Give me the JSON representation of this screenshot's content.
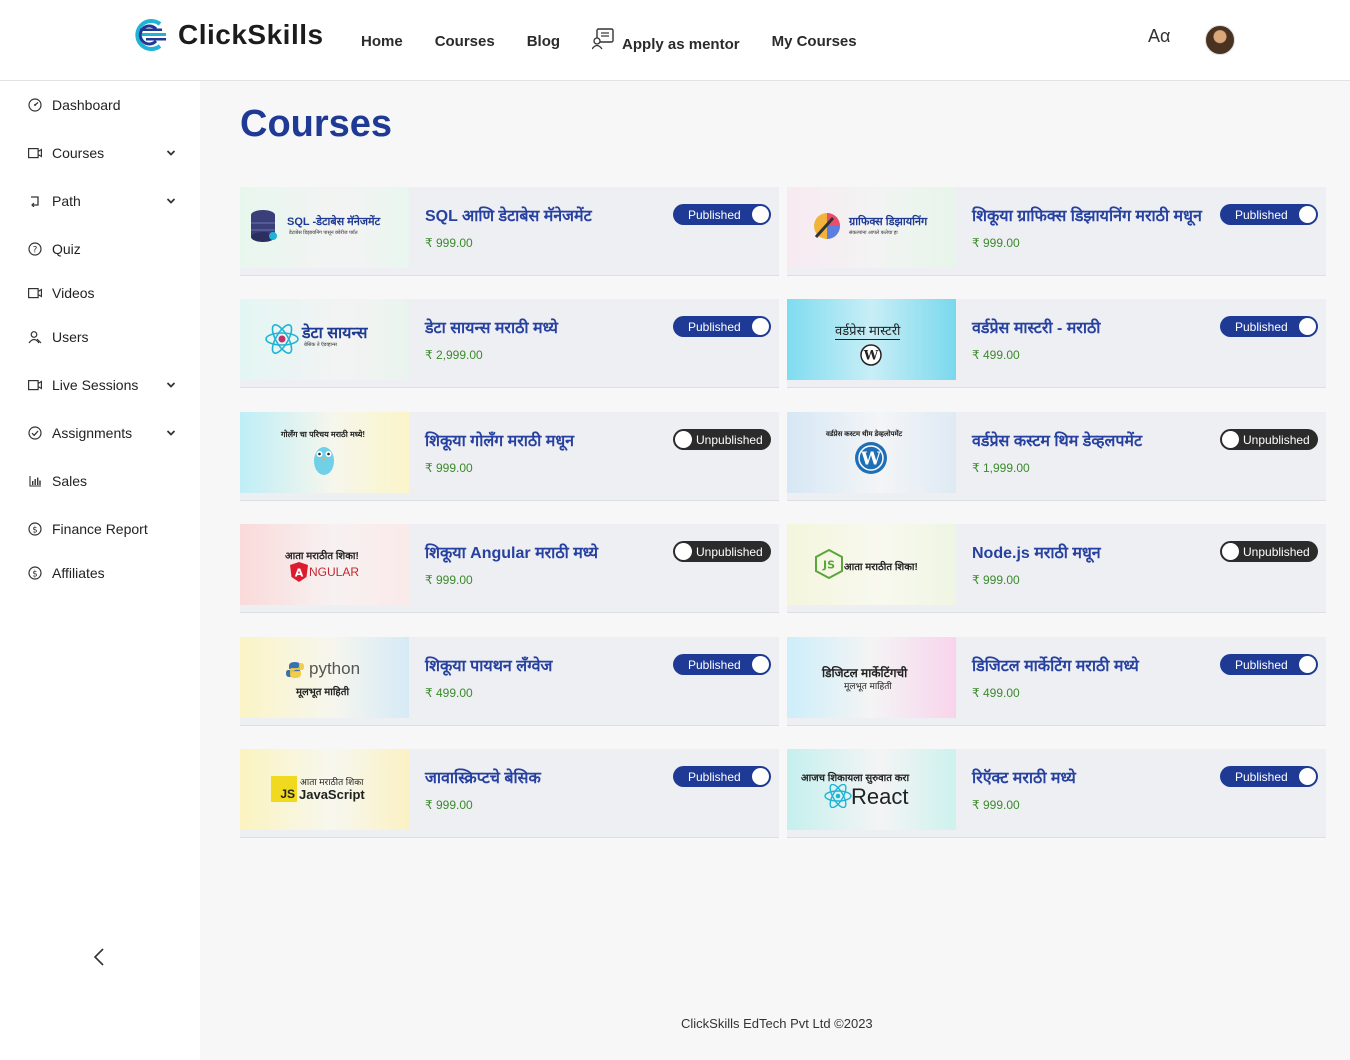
{
  "brand": {
    "name": "ClickSkills"
  },
  "nav": {
    "home": "Home",
    "courses": "Courses",
    "blog": "Blog",
    "mentor": "Apply as mentor",
    "my_courses": "My Courses",
    "font_toggle": "Aα"
  },
  "sidebar": {
    "items": [
      {
        "label": "Dashboard",
        "icon": "dashboard-icon"
      },
      {
        "label": "Courses",
        "icon": "video-icon",
        "expandable": true
      },
      {
        "label": "Path",
        "icon": "path-icon",
        "expandable": true
      },
      {
        "label": "Quiz",
        "icon": "quiz-icon"
      },
      {
        "label": "Videos",
        "icon": "video-icon"
      },
      {
        "label": "Users",
        "icon": "users-icon"
      },
      {
        "label": "Live Sessions",
        "icon": "video-icon",
        "expandable": true
      },
      {
        "label": "Assignments",
        "icon": "check-circle-icon",
        "expandable": true
      },
      {
        "label": "Sales",
        "icon": "bar-chart-icon"
      },
      {
        "label": "Finance Report",
        "icon": "dollar-icon"
      },
      {
        "label": "Affiliates",
        "icon": "dollar-icon"
      }
    ]
  },
  "main": {
    "title": "Courses",
    "courses": [
      {
        "title": "SQL आणि डेटाबेस मॅनेजमेंट",
        "price": "₹ 999.00",
        "status": "Published",
        "thumb_title": "SQL -डेटाबेस मॅनेजमेंट",
        "thumb_sub": "डेटाबेस डिझायनिंग पासून क्वेरीज पर्यंत"
      },
      {
        "title": "शिकूया ग्राफिक्स डिझायनिंग मराठी मधून",
        "price": "₹ 999.00",
        "status": "Published",
        "thumb_title": "ग्राफिक्स डिझायनिंग",
        "thumb_sub": "संकल्पांना आपले कलेचा हा"
      },
      {
        "title": "डेटा सायन्स मराठी मध्ये",
        "price": "₹ 2,999.00",
        "status": "Published",
        "thumb_title": "डेटा सायन्स",
        "thumb_sub": "बेसिक ते ऍडव्हान्स"
      },
      {
        "title": "वर्डप्रेस मास्टरी - मराठी",
        "price": "₹ 499.00",
        "status": "Published",
        "thumb_title": "वर्डप्रेस मास्टरी",
        "thumb_sub": ""
      },
      {
        "title": "शिकूया गोलॅंग मराठी मधून",
        "price": "₹ 999.00",
        "status": "Unpublished",
        "thumb_title": "गोलॅंग चा परिचय मराठी मध्ये!",
        "thumb_sub": ""
      },
      {
        "title": "वर्डप्रेस कस्टम थिम डेव्हलपमेंट",
        "price": "₹ 1,999.00",
        "status": "Unpublished",
        "thumb_title": "वर्डप्रेस कस्टम थीम डेव्हलोपमेंट",
        "thumb_sub": ""
      },
      {
        "title": "शिकूया Angular मराठी मध्ये",
        "price": "₹ 999.00",
        "status": "Unpublished",
        "thumb_title": "आता मराठीत शिका!",
        "thumb_sub": "NGULAR"
      },
      {
        "title": "Node.js मराठी मधून",
        "price": "₹ 999.00",
        "status": "Unpublished",
        "thumb_title": "आता मराठीत शिका!",
        "thumb_sub": ""
      },
      {
        "title": "शिकूया पायथन लॅंग्वेज",
        "price": "₹ 499.00",
        "status": "Published",
        "thumb_title": "python",
        "thumb_sub": "मूलभूत माहिती"
      },
      {
        "title": "डिजिटल मार्केटिंग मराठी मध्ये",
        "price": "₹ 499.00",
        "status": "Published",
        "thumb_title": "डिजिटल मार्केटिंगची",
        "thumb_sub": "मूलभूत माहिती"
      },
      {
        "title": "जावास्क्रिप्टचे बेसिक",
        "price": "₹ 999.00",
        "status": "Published",
        "thumb_title": "आता मराठीत शिका",
        "thumb_sub": "JavaScript"
      },
      {
        "title": "रिऍक्ट मराठी मध्ये",
        "price": "₹ 999.00",
        "status": "Published",
        "thumb_title": "आजच शिकायला सुरुवात करा",
        "thumb_sub": "React"
      }
    ]
  },
  "footer": {
    "text": "ClickSkills EdTech Pvt Ltd ©2023"
  },
  "colors": {
    "primary": "#1f3a94",
    "price": "#3a8a2c",
    "unpublished": "#2b2b2b"
  }
}
